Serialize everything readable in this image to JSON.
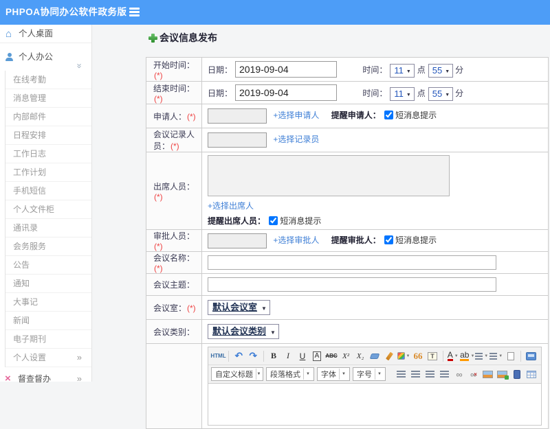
{
  "colors": {
    "header_bg": "#4d9df7",
    "link_blue": "#3f7fd6",
    "required_red": "#ee4444",
    "plus_green": "#3fa33f",
    "supervise_pink": "#e5679a"
  },
  "header": {
    "title": "PHPOA协同办公软件政务版"
  },
  "sidebar": {
    "desktop": "个人桌面",
    "office": "个人办公",
    "submenu": [
      "在线考勤",
      "消息管理",
      "内部邮件",
      "日程安排",
      "工作日志",
      "工作计划",
      "手机短信",
      "个人文件柜",
      "通讯录",
      "会务服务",
      "公告",
      "通知",
      "大事记",
      "新闻",
      "电子期刊"
    ],
    "settings": "个人设置",
    "supervision": "督查督办"
  },
  "form": {
    "title": "会议信息发布",
    "start_time": {
      "label": "开始时间：",
      "required": "(*)",
      "date_label": "日期：",
      "date_value": "2019-09-04",
      "time_label": "时间：",
      "hour": "11",
      "hour_unit": "点",
      "minute": "55",
      "minute_unit": "分"
    },
    "end_time": {
      "label": "结束时间：",
      "required": "(*)",
      "date_label": "日期：",
      "date_value": "2019-09-04",
      "time_label": "时间：",
      "hour": "11",
      "hour_unit": "点",
      "minute": "55",
      "minute_unit": "分"
    },
    "applicant": {
      "label": "申请人：",
      "required": "(*)",
      "link": "+选择申请人",
      "remind": "提醒申请人：",
      "sms": "短消息提示",
      "checked": "checked"
    },
    "recorder": {
      "label": "会议记录人员：",
      "required": "(*)",
      "link": "+选择记录员"
    },
    "attendees": {
      "label": "出席人员：",
      "required": "(*)",
      "link": "+选择出席人",
      "remind": "提醒出席人员：",
      "sms": "短消息提示",
      "checked": "checked"
    },
    "approver": {
      "label": "审批人员：",
      "required": "(*)",
      "link": "+选择审批人",
      "remind": "提醒审批人：",
      "sms": "短消息提示",
      "checked": "checked"
    },
    "name": {
      "label": "会议名称：",
      "required": "(*)"
    },
    "topic": {
      "label": "会议主题："
    },
    "room": {
      "label": "会议室：",
      "required": "(*)",
      "value": "默认会议室"
    },
    "category": {
      "label": "会议类别：",
      "value": "默认会议类别"
    }
  },
  "editor": {
    "glyphs": {
      "html": "HTML",
      "undo": "↶",
      "redo": "↷",
      "bold": "B",
      "italic": "I",
      "underline": "U",
      "fontbox": "A",
      "strike": "ABC",
      "sup": "X²",
      "sub": "X₂",
      "quote": "66",
      "paste": "T",
      "fontcolor": "A",
      "highlight": "ab",
      "link": "∞",
      "unlink": "∞",
      "unlink_x": "×"
    },
    "selects": [
      {
        "label": "自定义标题"
      },
      {
        "label": "段落格式"
      },
      {
        "label": "字体"
      },
      {
        "label": "字号"
      }
    ]
  }
}
